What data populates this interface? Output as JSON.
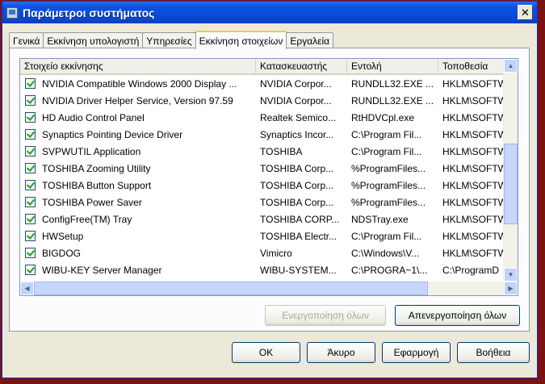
{
  "window": {
    "title": "Παράμετροι συστήματος",
    "close_glyph": "✕"
  },
  "tabs": [
    {
      "label": "Γενικά",
      "active": false
    },
    {
      "label": "Εκκίνηση υπολογιστή",
      "active": false
    },
    {
      "label": "Υπηρεσίες",
      "active": false
    },
    {
      "label": "Εκκίνηση στοιχείων",
      "active": true
    },
    {
      "label": "Εργαλεία",
      "active": false
    }
  ],
  "columns": [
    "Στοιχείο εκκίνησης",
    "Κατασκευαστής",
    "Εντολή",
    "Τοποθεσία"
  ],
  "rows": [
    {
      "checked": true,
      "item": "NVIDIA Compatible Windows 2000 Display ...",
      "manufacturer": "NVIDIA Corpor...",
      "command": "RUNDLL32.EXE ...",
      "location": "HKLM\\SOFTW"
    },
    {
      "checked": true,
      "item": "NVIDIA Driver Helper Service, Version 97.59",
      "manufacturer": "NVIDIA Corpor...",
      "command": "RUNDLL32.EXE ...",
      "location": "HKLM\\SOFTW"
    },
    {
      "checked": true,
      "item": "HD Audio Control Panel",
      "manufacturer": "Realtek Semico...",
      "command": "RtHDVCpl.exe",
      "location": "HKLM\\SOFTW"
    },
    {
      "checked": true,
      "item": "Synaptics Pointing Device Driver",
      "manufacturer": "Synaptics Incor...",
      "command": "C:\\Program Fil...",
      "location": "HKLM\\SOFTW"
    },
    {
      "checked": true,
      "item": "SVPWUTIL Application",
      "manufacturer": "TOSHIBA",
      "command": "C:\\Program Fil...",
      "location": "HKLM\\SOFTW"
    },
    {
      "checked": true,
      "item": "TOSHIBA Zooming Utility",
      "manufacturer": "TOSHIBA Corp...",
      "command": "%ProgramFiles...",
      "location": "HKLM\\SOFTW"
    },
    {
      "checked": true,
      "item": "TOSHIBA Button Support",
      "manufacturer": "TOSHIBA Corp...",
      "command": "%ProgramFiles...",
      "location": "HKLM\\SOFTW"
    },
    {
      "checked": true,
      "item": "TOSHIBA Power Saver",
      "manufacturer": "TOSHIBA Corp...",
      "command": "%ProgramFiles...",
      "location": "HKLM\\SOFTW"
    },
    {
      "checked": true,
      "item": "ConfigFree(TM) Tray",
      "manufacturer": "TOSHIBA CORP...",
      "command": "NDSTray.exe",
      "location": "HKLM\\SOFTW"
    },
    {
      "checked": true,
      "item": "HWSetup",
      "manufacturer": "TOSHIBA Electr...",
      "command": "C:\\Program Fil...",
      "location": "HKLM\\SOFTW"
    },
    {
      "checked": true,
      "item": "BIGDOG",
      "manufacturer": "Vimicro",
      "command": "C:\\Windows\\V...",
      "location": "HKLM\\SOFTW"
    },
    {
      "checked": true,
      "item": "WIBU-KEY Server Manager",
      "manufacturer": "WIBU-SYSTEM...",
      "command": "C:\\PROGRA~1\\...",
      "location": "C:\\ProgramD"
    }
  ],
  "buttons": {
    "enable_all": "Ενεργοποίηση όλων",
    "disable_all": "Απενεργοποίηση όλων",
    "ok": "OK",
    "cancel": "Άκυρο",
    "apply": "Εφαρμογή",
    "help": "Βοήθεια"
  },
  "icons": {
    "scroll_up": "▲",
    "scroll_down": "▼",
    "scroll_left": "◀",
    "scroll_right": "▶"
  },
  "colors": {
    "titlebar": "#0a49d6",
    "dialog": "#ece9d8",
    "check": "#21a121"
  }
}
